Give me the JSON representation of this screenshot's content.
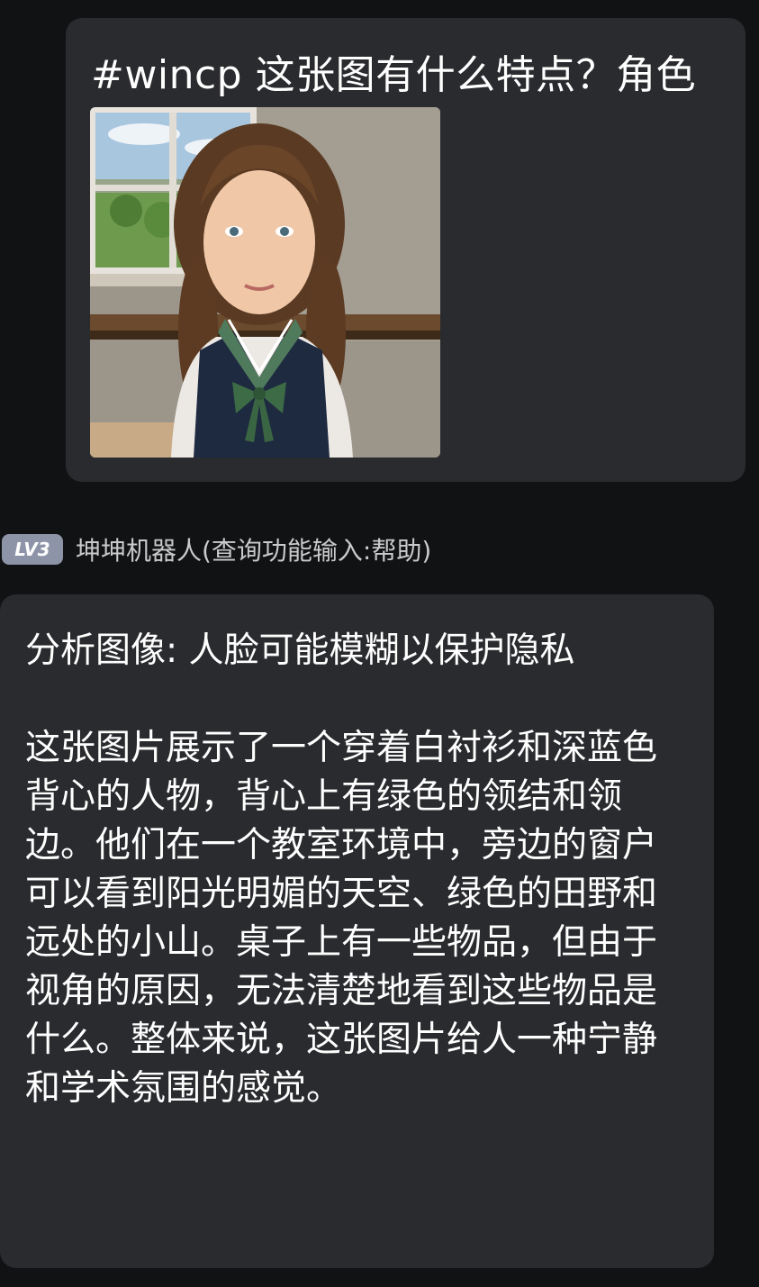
{
  "user_message": {
    "text": "#wincp 这张图有什么特点？角色",
    "image_alt": "girl-in-classroom-portrait"
  },
  "bot": {
    "level_badge": "LV3",
    "name": "坤坤机器人(查询功能输入:帮助)",
    "reply_heading": "分析图像: 人脸可能模糊以保护隐私",
    "reply_body": "这张图片展示了一个穿着白衬衫和深蓝色背心的人物，背心上有绿色的领结和领边。他们在一个教室环境中，旁边的窗户可以看到阳光明媚的天空、绿色的田野和远处的小山。桌子上有一些物品，但由于视角的原因，无法清楚地看到这些物品是什么。整体来说，这张图片给人一种宁静和学术氛围的感觉。"
  },
  "colors": {
    "background": "#111214",
    "bubble": "#2a2b2e",
    "badge": "#8e94a8",
    "sender_text": "#c9cacc"
  }
}
